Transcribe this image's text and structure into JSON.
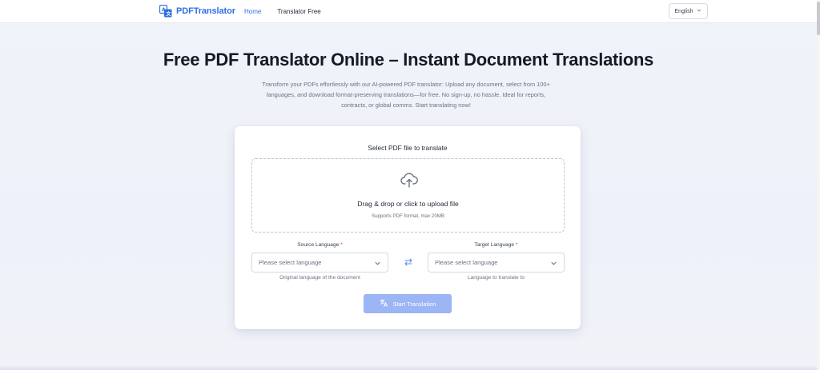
{
  "header": {
    "logo_text": "PDFTranslator",
    "nav": [
      {
        "label": "Home",
        "active": true
      },
      {
        "label": "Translator Free",
        "active": false
      }
    ],
    "language": "English"
  },
  "hero": {
    "title": "Free PDF Translator Online – Instant Document Translations",
    "description": "Transform your PDFs effortlessly with our AI-powered PDF translator: Upload any document, select from 100+ languages, and download format-preserving translations—for free. No sign-up, no hassle. Ideal for reports, contracts, or global comms. Start translating now!"
  },
  "upload": {
    "title": "Select PDF file to translate",
    "dropzone_main": "Drag & drop or click to upload file",
    "dropzone_sub": "Supports PDF format, max 20MB"
  },
  "source": {
    "label": "Source Language",
    "required_mark": "*",
    "placeholder": "Please select language",
    "hint": "Original language of the document"
  },
  "target": {
    "label": "Target Language",
    "required_mark": "*",
    "placeholder": "Please select language",
    "hint": "Language to translate to"
  },
  "action": {
    "start_label": "Start Translation"
  },
  "icons": [
    "logo-icon",
    "chevron-down-icon",
    "cloud-upload-icon",
    "swap-icon",
    "translate-icon"
  ],
  "colors": {
    "accent": "#2f6fe4",
    "button_disabled": "#9bb5f5",
    "required": "#e03131"
  }
}
